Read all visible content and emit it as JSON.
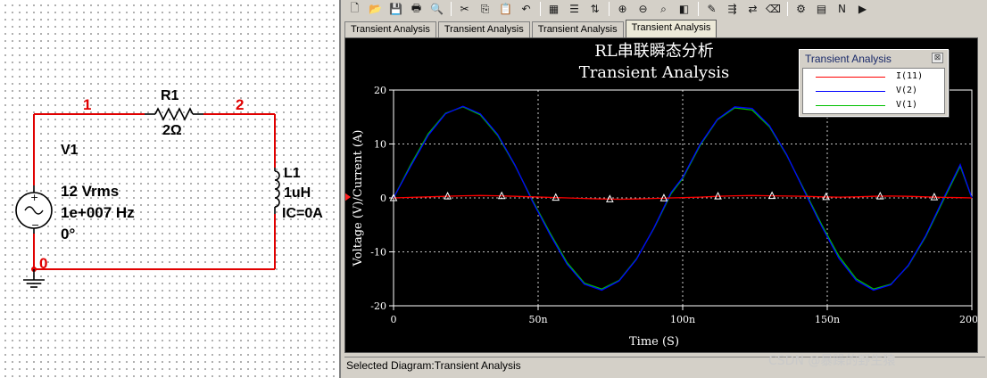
{
  "schematic": {
    "source": {
      "name": "V1",
      "amplitude": "12 Vrms",
      "frequency": "1e+007 Hz",
      "phase": "0°"
    },
    "resistor": {
      "name": "R1",
      "value": "2Ω"
    },
    "inductor": {
      "name": "L1",
      "value": "1uH",
      "ic": "IC=0A"
    },
    "nets": [
      "1",
      "2",
      "0"
    ]
  },
  "toolbar": {
    "icons": [
      "new-icon",
      "open-icon",
      "save-icon",
      "print-icon",
      "print-preview-icon",
      "cut-icon",
      "copy-icon",
      "paste-icon",
      "undo-icon",
      "grid-icon",
      "legend-icon",
      "cursor-icon",
      "zoom-in-icon",
      "zoom-out-icon",
      "zoom-area-icon",
      "black-white-icon",
      "add-trace-icon",
      "overlay-traces-icon",
      "reverse-colors-icon",
      "clear-icon",
      "properties-icon",
      "export-excel-icon",
      "export-mathcad-icon",
      "export-labview-icon"
    ],
    "glyphs": [
      "🗋",
      "📂",
      "💾",
      "🖶",
      "🔍",
      "✂",
      "⎘",
      "📋",
      "↶",
      "▦",
      "☰",
      "⇅",
      "⊕",
      "⊖",
      "⌕",
      "◧",
      "✎",
      "⇶",
      "⇄",
      "⌫",
      "⚙",
      "▤",
      "N",
      "▶"
    ]
  },
  "tabs": [
    {
      "label": "Transient Analysis",
      "active": false
    },
    {
      "label": "Transient Analysis",
      "active": false
    },
    {
      "label": "Transient Analysis",
      "active": false
    },
    {
      "label": "Transient Analysis",
      "active": true
    }
  ],
  "legend": {
    "title": "Transient Analysis",
    "close": "⊠",
    "entries": [
      {
        "label": "I(11)",
        "color": "#ff0000"
      },
      {
        "label": "V(2)",
        "color": "#0000ff"
      },
      {
        "label": "V(1)",
        "color": "#00c000"
      }
    ]
  },
  "status": {
    "text": "Selected Diagram:Transient Analysis"
  },
  "watermark": {
    "text": "CSDN @暴躁的野生猿"
  },
  "chart_data": {
    "type": "line",
    "title": "RL串联瞬态分析",
    "subtitle": "Transient Analysis",
    "xlabel": "Time (S)",
    "ylabel": "Voltage (V)/Current (A)",
    "xlim": [
      0,
      200
    ],
    "ylim": [
      -20,
      20
    ],
    "x_ticks": [
      "0",
      "50n",
      "100n",
      "150n",
      "200n"
    ],
    "y_ticks": [
      "20",
      "10",
      "0",
      "-10",
      "-20"
    ],
    "x_unit": "ns",
    "grid": true,
    "legend_placement": "top-right",
    "x": [
      0,
      6,
      12,
      18,
      24,
      30,
      36,
      42,
      48,
      54,
      60,
      66,
      72,
      78,
      84,
      90,
      96,
      100,
      106,
      112,
      118,
      124,
      130,
      136,
      142,
      148,
      154,
      160,
      166,
      172,
      178,
      184,
      190,
      196,
      200
    ],
    "series": [
      {
        "name": "V(1)",
        "color": "#00c000",
        "values": [
          0,
          6.2,
          11.9,
          15.7,
          16.9,
          15.4,
          11.6,
          6.0,
          -0.4,
          -6.4,
          -12.0,
          -15.8,
          -16.9,
          -15.3,
          -11.3,
          -5.7,
          0.8,
          3.6,
          9.7,
          14.5,
          16.7,
          16.3,
          13.2,
          7.9,
          1.5,
          -4.9,
          -10.8,
          -15.0,
          -16.9,
          -16.0,
          -12.6,
          -7.2,
          -0.6,
          5.9,
          0
        ]
      },
      {
        "name": "V(2)",
        "color": "#0000ff",
        "values": [
          0,
          5.9,
          11.6,
          15.6,
          17.0,
          15.6,
          11.8,
          6.1,
          -0.6,
          -6.7,
          -12.3,
          -16.0,
          -17.1,
          -15.4,
          -11.4,
          -5.6,
          1.0,
          3.8,
          9.9,
          14.6,
          16.9,
          16.6,
          13.4,
          8.0,
          1.3,
          -5.2,
          -11.2,
          -15.3,
          -17.1,
          -16.1,
          -12.5,
          -7.0,
          -0.3,
          6.2,
          0
        ]
      },
      {
        "name": "I(11)",
        "color": "#ff0000",
        "marker": "triangle",
        "values": [
          0,
          0.1,
          0.2,
          0.3,
          0.4,
          0.45,
          0.4,
          0.3,
          0.2,
          0.1,
          0.0,
          -0.1,
          -0.2,
          -0.25,
          -0.2,
          -0.1,
          0.0,
          0.05,
          0.15,
          0.3,
          0.4,
          0.45,
          0.4,
          0.35,
          0.3,
          0.2,
          0.15,
          0.2,
          0.3,
          0.35,
          0.3,
          0.2,
          0.1,
          0.05,
          0.0
        ]
      }
    ],
    "markers_x": [
      0,
      18.7,
      37.4,
      56.1,
      74.8,
      93.5,
      112.2,
      130.9,
      149.6,
      168.3,
      187
    ]
  }
}
